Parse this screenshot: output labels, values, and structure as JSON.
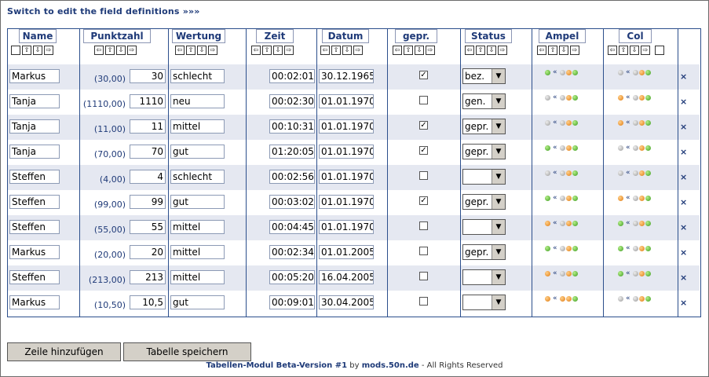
{
  "switch_link": "Switch to edit the field definitions »»»",
  "columns": [
    "Name",
    "Punktzahl",
    "Wertung",
    "Zeit",
    "Datum",
    "gepr.",
    "Status",
    "Ampel",
    "Col"
  ],
  "sort_icons": {
    "left": "⇦",
    "up": "⇧",
    "down": "⇩",
    "right": "⇨"
  },
  "rows": [
    {
      "name": "Markus",
      "punkte_paren": "(30,00)",
      "punkte": "30",
      "wertung": "schlecht",
      "zeit": "00:02:01",
      "datum": "30.12.1965",
      "gepr": true,
      "status": "bez.",
      "ampel": [
        "g",
        "s",
        "o",
        "g"
      ],
      "col": [
        "s",
        "s",
        "o",
        "g"
      ]
    },
    {
      "name": "Tanja",
      "punkte_paren": "(1110,00)",
      "punkte": "1110",
      "wertung": "neu",
      "zeit": "00:02:30",
      "datum": "01.01.1970",
      "gepr": false,
      "status": "gen.",
      "ampel": [
        "s",
        "s",
        "o",
        "g"
      ],
      "col": [
        "o",
        "s",
        "o",
        "g"
      ]
    },
    {
      "name": "Tanja",
      "punkte_paren": "(11,00)",
      "punkte": "11",
      "wertung": "mittel",
      "zeit": "00:10:31",
      "datum": "01.01.1970",
      "gepr": true,
      "status": "gepr.",
      "ampel": [
        "s",
        "s",
        "o",
        "g"
      ],
      "col": [
        "o",
        "s",
        "o",
        "g"
      ]
    },
    {
      "name": "Tanja",
      "punkte_paren": "(70,00)",
      "punkte": "70",
      "wertung": "gut",
      "zeit": "01:20:05",
      "datum": "01.01.1970",
      "gepr": true,
      "status": "gepr.",
      "ampel": [
        "g",
        "s",
        "o",
        "g"
      ],
      "col": [
        "s",
        "s",
        "o",
        "g"
      ]
    },
    {
      "name": "Steffen",
      "punkte_paren": "(4,00)",
      "punkte": "4",
      "wertung": "schlecht",
      "zeit": "00:02:56",
      "datum": "01.01.1970",
      "gepr": false,
      "status": "",
      "ampel": [
        "s",
        "s",
        "o",
        "g"
      ],
      "col": [
        "s",
        "s",
        "o",
        "g"
      ]
    },
    {
      "name": "Steffen",
      "punkte_paren": "(99,00)",
      "punkte": "99",
      "wertung": "gut",
      "zeit": "00:03:02",
      "datum": "01.01.1970",
      "gepr": true,
      "status": "gepr.",
      "ampel": [
        "g",
        "s",
        "o",
        "g"
      ],
      "col": [
        "o",
        "s",
        "o",
        "g"
      ]
    },
    {
      "name": "Steffen",
      "punkte_paren": "(55,00)",
      "punkte": "55",
      "wertung": "mittel",
      "zeit": "00:04:45",
      "datum": "01.01.1970",
      "gepr": false,
      "status": "",
      "ampel": [
        "o",
        "s",
        "o",
        "g"
      ],
      "col": [
        "g",
        "s",
        "o",
        "g"
      ]
    },
    {
      "name": "Markus",
      "punkte_paren": "(20,00)",
      "punkte": "20",
      "wertung": "mittel",
      "zeit": "00:02:34",
      "datum": "01.01.2005",
      "gepr": false,
      "status": "gepr.",
      "ampel": [
        "g",
        "s",
        "o",
        "g"
      ],
      "col": [
        "g",
        "s",
        "o",
        "g"
      ]
    },
    {
      "name": "Steffen",
      "punkte_paren": "(213,00)",
      "punkte": "213",
      "wertung": "mittel",
      "zeit": "00:05:20",
      "datum": "16.04.2005",
      "gepr": false,
      "status": "",
      "ampel": [
        "o",
        "s",
        "o",
        "g"
      ],
      "col": [
        "g",
        "s",
        "o",
        "g"
      ]
    },
    {
      "name": "Markus",
      "punkte_paren": "(10,50)",
      "punkte": "10,5",
      "wertung": "gut",
      "zeit": "00:09:01",
      "datum": "30.04.2005",
      "gepr": false,
      "status": "",
      "ampel": [
        "o",
        "o",
        "o",
        "g"
      ],
      "col": [
        "s",
        "s",
        "o",
        "g"
      ]
    }
  ],
  "ampel_sep": "«",
  "delete_icon": "×",
  "buttons": {
    "add_row": "Zeile hinzufügen",
    "save_table": "Tabelle speichern"
  },
  "footer": {
    "product": "Tabellen-Modul Beta-Version #1",
    "by": "by",
    "site": "mods.50n.de",
    "rights": "- All Rights Reserved"
  }
}
